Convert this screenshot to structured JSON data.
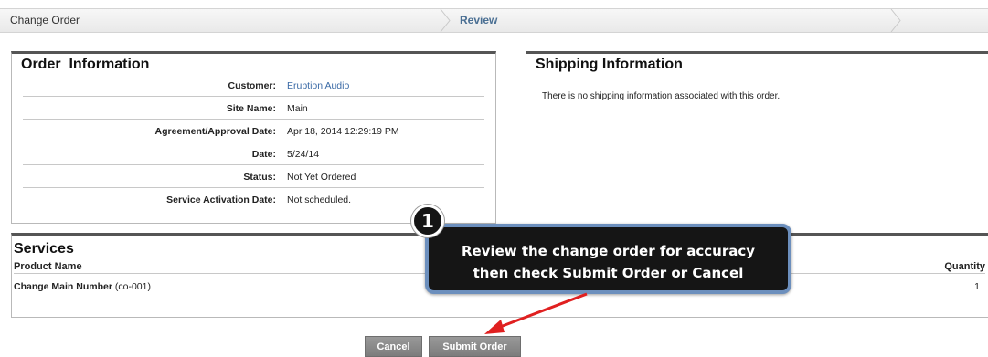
{
  "wizard": {
    "steps": [
      "Change Order",
      "Review"
    ],
    "corner_text": "· · · · · ·"
  },
  "order_info": {
    "title": "Order  Information",
    "rows": [
      {
        "label": "Customer:",
        "value": "Eruption Audio"
      },
      {
        "label": "Site Name:",
        "value": "Main"
      },
      {
        "label": "Agreement/Approval Date:",
        "value": "Apr 18, 2014 12:29:19 PM"
      },
      {
        "label": "Date:",
        "value": "5/24/14"
      },
      {
        "label": "Status:",
        "value": "Not Yet Ordered"
      },
      {
        "label": "Service Activation Date:",
        "value": "Not scheduled."
      }
    ]
  },
  "shipping": {
    "title": "Shipping Information",
    "message": "There is no shipping information associated with this order."
  },
  "services": {
    "title": "Services",
    "columns": [
      "Product Name",
      "Quantity"
    ],
    "rows": [
      {
        "name": "Change Main Number",
        "code": "(co-001)",
        "quantity": "1"
      }
    ]
  },
  "buttons": {
    "cancel": "Cancel",
    "submit": "Submit Order"
  },
  "callout": {
    "badge": "1",
    "line1": "Review the change order for accuracy",
    "line2": "then check Submit Order or Cancel"
  },
  "colors": {
    "link": "#3a6aa6",
    "callout_border": "#6c8fbd",
    "arrow": "#e02020"
  }
}
